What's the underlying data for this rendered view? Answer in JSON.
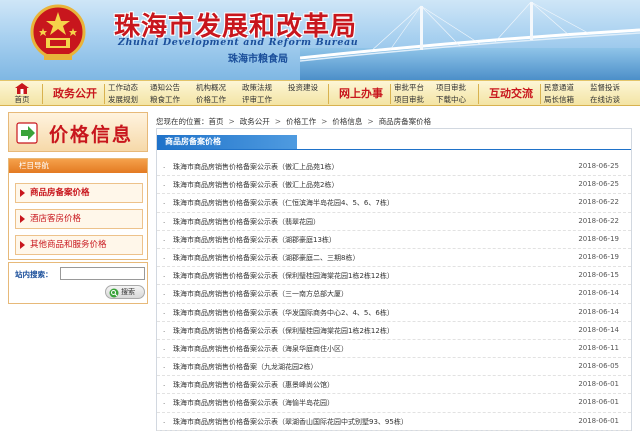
{
  "header": {
    "title_cn": "珠海市发展和改革局",
    "title_en": "Zhuhai Development and Reform Bureau",
    "sub_bureau": "珠海市粮食局"
  },
  "nav": {
    "home": "首页",
    "sec1": "政务公开",
    "col1": [
      "工作动态",
      "发展规划"
    ],
    "col2": [
      "通知公告",
      "粮食工作"
    ],
    "col3": [
      "机构概况",
      "价格工作"
    ],
    "col4": [
      "政策法规",
      "评审工作"
    ],
    "col5": [
      "投资建设"
    ],
    "sec2": "网上办事",
    "col6": [
      "审批平台",
      "项目审批"
    ],
    "col7": [
      "项目审批",
      "下载中心"
    ],
    "sec3": "互动交流",
    "col8": [
      "民意通道",
      "局长信箱"
    ],
    "col9": [
      "监督投诉",
      "在线访谈"
    ]
  },
  "sidebar": {
    "title": "价格信息",
    "section_head": "栏目导航",
    "items": [
      {
        "label": "商品房备案价格"
      },
      {
        "label": "酒店客房价格"
      },
      {
        "label": "其他商品和服务价格"
      }
    ],
    "search_label": "站内搜索：",
    "search_value": "",
    "search_button": "搜索"
  },
  "breadcrumb": {
    "prefix": "您现在的位置：",
    "items": [
      "首页",
      "政务公开",
      "价格工作",
      "价格信息",
      "商品房备案价格"
    ]
  },
  "list": {
    "title": "商品房备案价格",
    "rows": [
      {
        "title": "珠海市商品房销售价格备案公示表（傲汇上品苑1栋）",
        "date": "2018-06-25"
      },
      {
        "title": "珠海市商品房销售价格备案公示表（傲汇上品苑2栋）",
        "date": "2018-06-25"
      },
      {
        "title": "珠海市商品房销售价格备案公示表（仁恒滨海半岛花园4、5、6、7栋）",
        "date": "2018-06-22"
      },
      {
        "title": "珠海市商品房销售价格备案公示表（翡翠花园）",
        "date": "2018-06-22"
      },
      {
        "title": "珠海市商品房销售价格备案公示表（湖郡豪庭13栋）",
        "date": "2018-06-19"
      },
      {
        "title": "珠海市商品房销售价格备案公示表（湖郡豪庭二、三期8栋）",
        "date": "2018-06-19"
      },
      {
        "title": "珠海市商品房销售价格备案公示表（保利璧桂园海棠花园1栋2栋12栋）",
        "date": "2018-06-15"
      },
      {
        "title": "珠海市商品房销售价格备案公示表（三一南方总部大厦）",
        "date": "2018-06-14"
      },
      {
        "title": "珠海市商品房销售价格备案公示表（华发国际商务中心2、4、5、6栋）",
        "date": "2018-06-14"
      },
      {
        "title": "珠海市商品房销售价格备案公示表（保利璧桂园海棠花园1栋2栋12栋）",
        "date": "2018-06-14"
      },
      {
        "title": "珠海市商品房销售价格备案公示表（海泉华庭商住小区）",
        "date": "2018-06-11"
      },
      {
        "title": "珠海市商品房销售价格备案（九龙湖花园2栋）",
        "date": "2018-06-05"
      },
      {
        "title": "珠海市商品房销售价格备案公示表（惠景峰尚公馆）",
        "date": "2018-06-01"
      },
      {
        "title": "珠海市商品房销售价格备案公示表（海愉半岛花园）",
        "date": "2018-06-01"
      },
      {
        "title": "珠海市商品房销售价格备案公示表（翠湖香山国际花园中式别墅93、95栋）",
        "date": "2018-06-01"
      }
    ]
  },
  "colors": {
    "brand_red": "#c8161d",
    "brand_blue": "#1b4f9b",
    "nav_bg": "#f3e4a4",
    "section_blue": "#1f72c9",
    "sidebar_orange": "#e37a22"
  }
}
